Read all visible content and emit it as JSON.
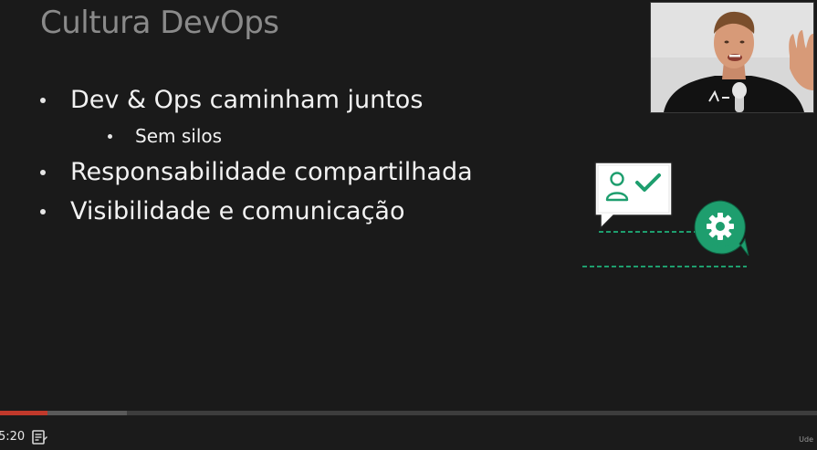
{
  "slide": {
    "title": "Cultura DevOps",
    "bullets": [
      {
        "text": "Dev & Ops caminham juntos",
        "level": 1
      },
      {
        "text": "Sem silos",
        "level": 2
      },
      {
        "text": "Responsabilidade compartilhada",
        "level": 1
      },
      {
        "text": "Visibilidade e comunicação",
        "level": 1
      }
    ],
    "illustration": {
      "icons": [
        "user-check-icon",
        "gear-icon"
      ],
      "accent_color": "#1e9e6e"
    }
  },
  "webcam": {
    "description_icon": "instructor-video-icon"
  },
  "player": {
    "current_time": "5:20",
    "progress_fraction": 0.058,
    "buffered_fraction": 0.155,
    "progress_color": "#c0392b",
    "notes_icon": "notes-icon",
    "brand": "Ude"
  }
}
